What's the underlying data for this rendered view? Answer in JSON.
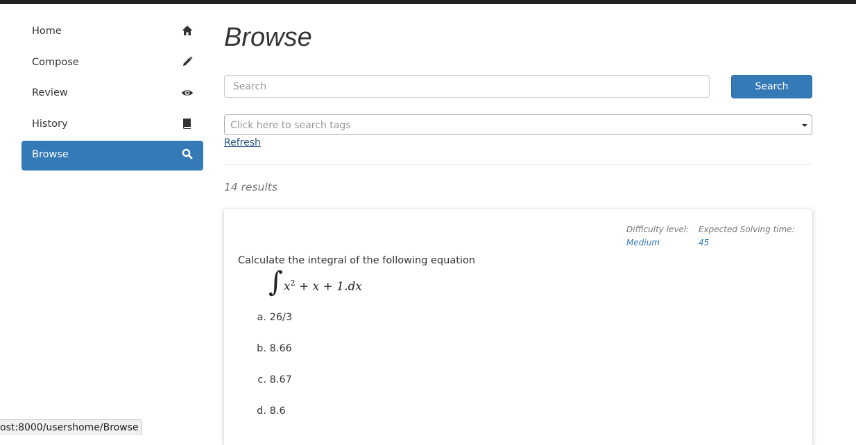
{
  "sidebar": {
    "items": [
      {
        "label": "Home",
        "icon": "home-icon",
        "active": false
      },
      {
        "label": "Compose",
        "icon": "pencil-icon",
        "active": false
      },
      {
        "label": "Review",
        "icon": "eye-icon",
        "active": false
      },
      {
        "label": "History",
        "icon": "book-icon",
        "active": false
      },
      {
        "label": "Browse",
        "icon": "search-icon",
        "active": true
      }
    ]
  },
  "page": {
    "title": "Browse"
  },
  "search": {
    "placeholder": "Search",
    "value": "",
    "button_label": "Search"
  },
  "tags": {
    "placeholder": "Click here to search tags"
  },
  "refresh_label": "Refresh",
  "results": {
    "count_text": "14 results"
  },
  "question": {
    "difficulty_label": "Difficulty level:",
    "difficulty_value": "Medium",
    "time_label": "Expected Solving time:",
    "time_value": "45",
    "text": "Calculate the integral of the following equation",
    "options": [
      {
        "letter": "a.",
        "text": "26/3"
      },
      {
        "letter": "b.",
        "text": "8.66"
      },
      {
        "letter": "c.",
        "text": "8.67"
      },
      {
        "letter": "d.",
        "text": "8.6"
      }
    ]
  },
  "status_bar": {
    "url": "ost:8000/usershome/Browse"
  },
  "colors": {
    "accent": "#337ab7",
    "link": "#23527c",
    "muted": "#777777"
  }
}
